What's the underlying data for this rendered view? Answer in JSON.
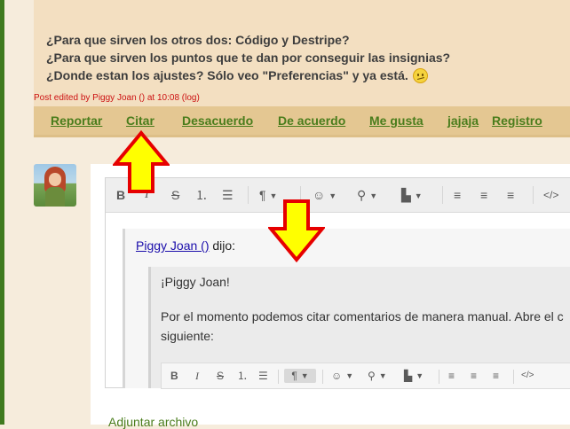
{
  "post": {
    "lines": [
      "¿Para que sirven los otros dos: Código y Destripe?",
      "¿Para que sirven los puntos que te dan por conseguir las insignias?",
      "¿Donde estan los ajustes? Sólo veo \"Preferencias\" y ya está."
    ],
    "edited_prefix": "Post edited by ",
    "edited_user": "Piggy Joan ()",
    "edited_suffix": " at 10:08 (log)"
  },
  "actions": [
    "Reportar",
    "Citar",
    "Desacuerdo",
    "De acuerdo",
    "Me gusta",
    "jajaja",
    "Registro"
  ],
  "toolbar": {
    "bold": "B",
    "italic": "I",
    "strike": "S",
    "ordered_list": "⒈",
    "bullet_list": "☰",
    "paragraph": "¶",
    "emoji": "☺",
    "link": "⚲",
    "file": "▙",
    "align_left": "≡",
    "align_center": "≡",
    "align_right": "≡",
    "code": "</>"
  },
  "quote": {
    "author": "Piggy Joan ()",
    "said": " dijo:",
    "greeting": "¡Piggy Joan!",
    "body_line1": "Por el momento podemos citar comentarios de manera manual. Abre el c",
    "body_line2": "siguiente:"
  },
  "attach_label": "Adjuntar archivo",
  "colors": {
    "accent_green": "#4a7d1c",
    "arrow_yellow": "#ffff00",
    "arrow_red": "#e60000"
  }
}
